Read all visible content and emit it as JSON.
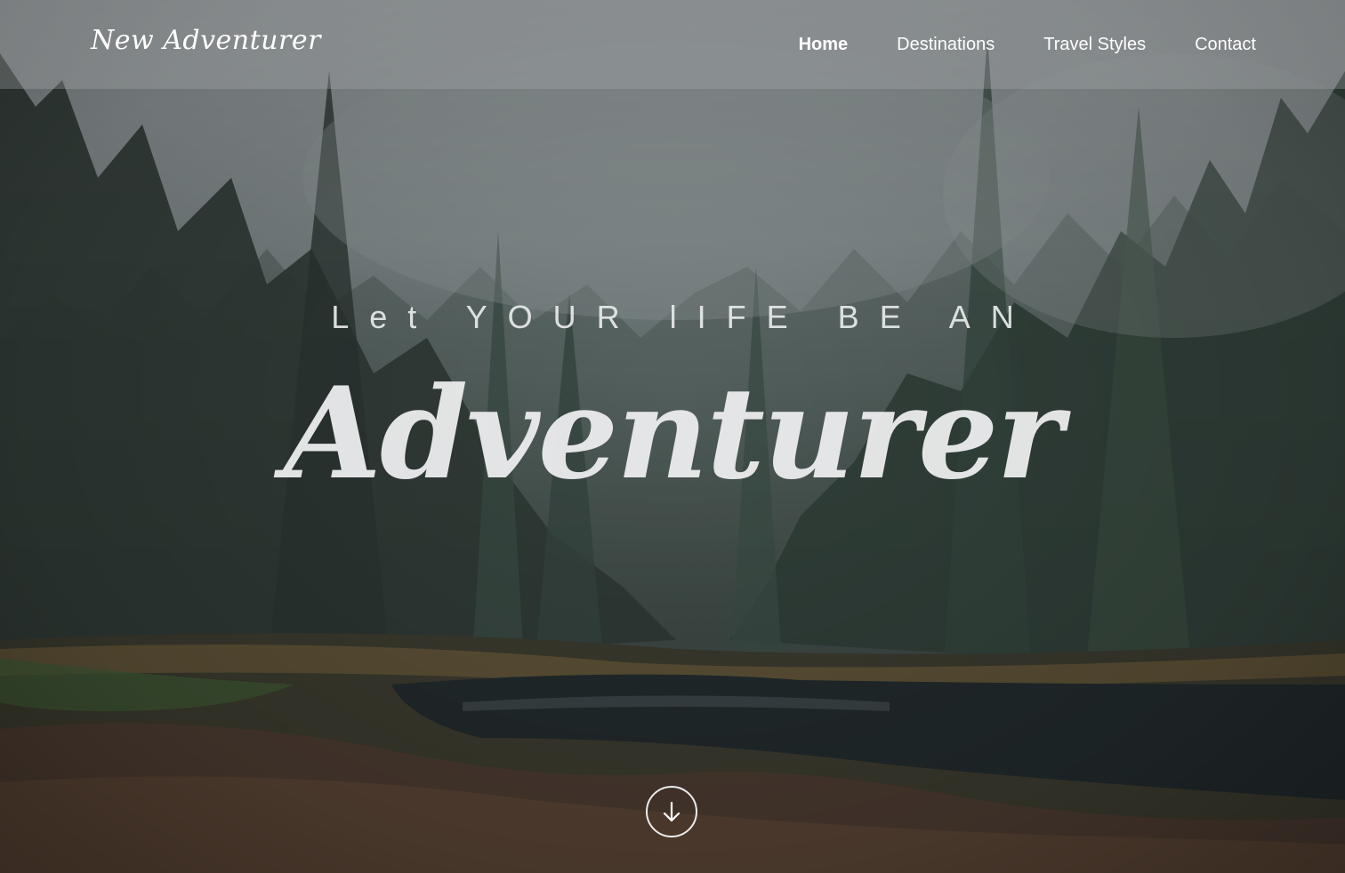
{
  "header": {
    "logo_text": "New Adventurer",
    "nav": [
      {
        "label": "Home",
        "active": true
      },
      {
        "label": "Destinations",
        "active": false
      },
      {
        "label": "Travel Styles",
        "active": false
      },
      {
        "label": "Contact",
        "active": false
      }
    ]
  },
  "hero": {
    "tagline": "Let YOUR lIFE BE AN",
    "headline": "Adventurer",
    "background_image": "misty pine forest with river",
    "scroll_icon": "arrow-down-icon"
  },
  "colors": {
    "text": "#ffffff",
    "header_overlay": "rgba(170,175,178,0.32)"
  }
}
